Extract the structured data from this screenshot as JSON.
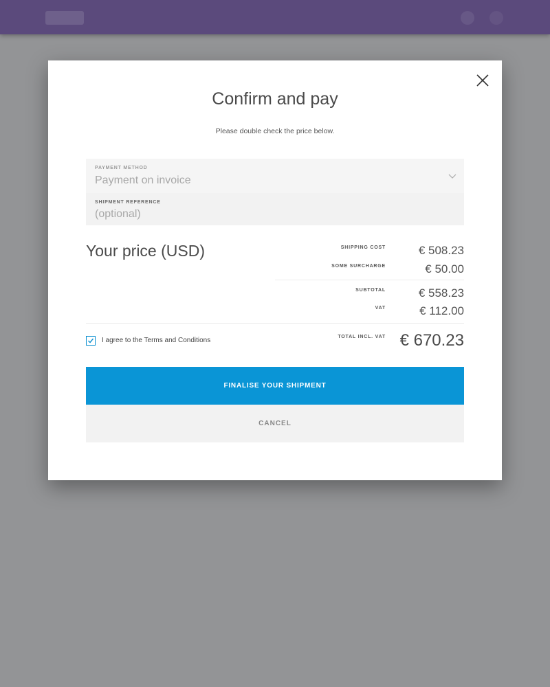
{
  "modal": {
    "title": "Confirm and pay",
    "subtitle": "Please double check the price below."
  },
  "payment_method": {
    "label": "PAYMENT METHOD",
    "value": "Payment on invoice"
  },
  "shipment_reference": {
    "label": "SHIPMENT REFERENCE",
    "placeholder": "(optional)"
  },
  "price": {
    "heading": "Your price (USD)",
    "shipping_cost_label": "SHIPPING COST",
    "shipping_cost_value": "€ 508.23",
    "surcharge_label": "SOME SURCHARGE",
    "surcharge_value": "€ 50.00",
    "subtotal_label": "SUBTOTAL",
    "subtotal_value": "€ 558.23",
    "vat_label": "VAT",
    "vat_value": "€ 112.00",
    "total_label": "TOTAL INCL. VAT",
    "total_value": "€ 670.23"
  },
  "terms": {
    "checked": true,
    "prefix": "I agree to the ",
    "link": "Terms and Conditions"
  },
  "buttons": {
    "finalise": "FINALISE YOUR SHIPMENT",
    "cancel": "CANCEL"
  },
  "colors": {
    "topbar": "#5b4a7c",
    "overlay": "#939496",
    "primary": "#0a95d6",
    "secondary_bg": "#f2f2f2"
  },
  "icons": {
    "close": "close-icon",
    "dropdown": "chevron-down-icon",
    "check": "checkmark-icon"
  }
}
